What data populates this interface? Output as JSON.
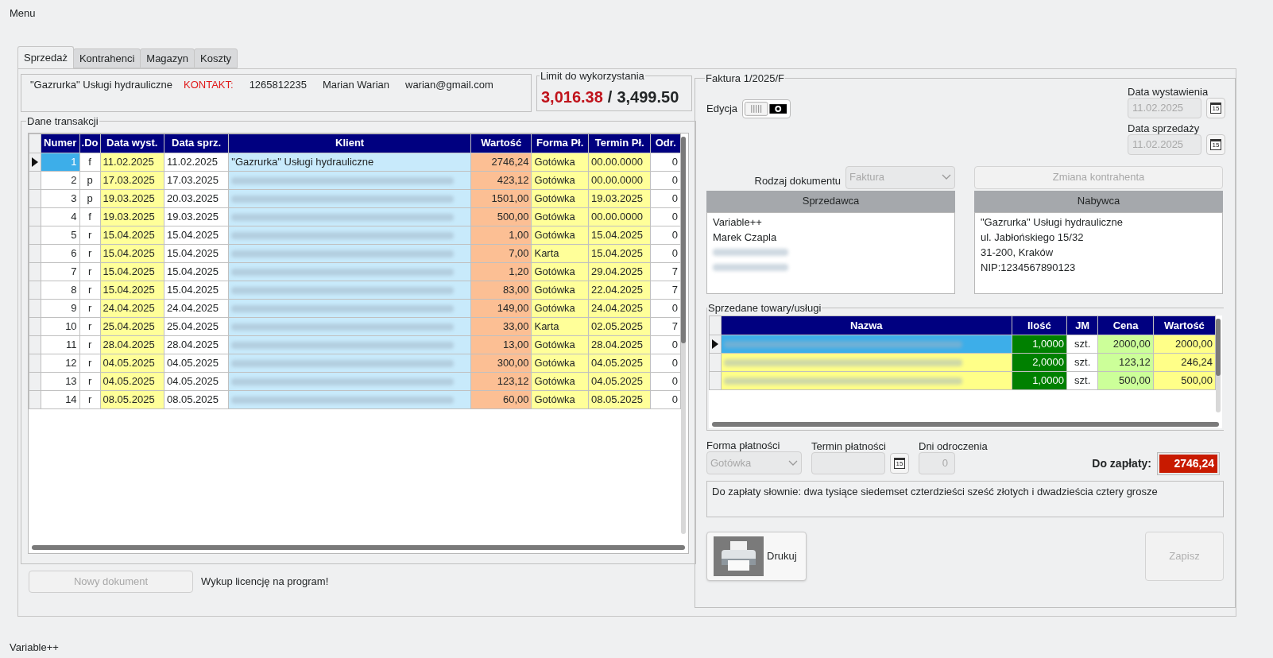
{
  "menu": {
    "label": "Menu"
  },
  "tabs": [
    {
      "label": "Sprzedaż",
      "selected": true
    },
    {
      "label": "Kontrahenci",
      "selected": false
    },
    {
      "label": "Magazyn",
      "selected": false
    },
    {
      "label": "Koszty",
      "selected": false
    }
  ],
  "contact": {
    "company": "\"Gazrurka\" Usługi hydrauliczne",
    "label": "KONTAKT:",
    "phone": "1265812235",
    "person": "Marian Warian",
    "email": "warian@gmail.com"
  },
  "limit": {
    "title": "Limit do wykorzystania",
    "used": "3,016.38",
    "separator": "/",
    "total": "3,499.50"
  },
  "transactions": {
    "title": "Dane transakcji",
    "columns": [
      "Numer",
      ".Do",
      "Data wyst.",
      "Data sprz.",
      "Klient",
      "Wartość",
      "Forma Pł.",
      "Termin Pł.",
      "Odr."
    ],
    "rows": [
      {
        "numer": "1",
        "do": "f",
        "issued": "11.02.2025",
        "sold": "11.02.2025",
        "client": {
          "kind": "text",
          "text": "\"Gazrurka\" Usługi hydrauliczne"
        },
        "value": "2746,24",
        "payment": "Gotówka",
        "due": "00.00.0000",
        "delay": "0",
        "selected": true
      },
      {
        "numer": "2",
        "do": "p",
        "issued": "17.03.2025",
        "sold": "17.03.2025",
        "client": {
          "kind": "redacted"
        },
        "value": "423,12",
        "payment": "Gotówka",
        "due": "00.00.0000",
        "delay": "0",
        "selected": false
      },
      {
        "numer": "3",
        "do": "p",
        "issued": "19.03.2025",
        "sold": "20.03.2025",
        "client": {
          "kind": "redacted"
        },
        "value": "1501,00",
        "payment": "Gotówka",
        "due": "19.03.2025",
        "delay": "0",
        "selected": false
      },
      {
        "numer": "4",
        "do": "f",
        "issued": "19.03.2025",
        "sold": "19.03.2025",
        "client": {
          "kind": "redacted"
        },
        "value": "500,00",
        "payment": "Gotówka",
        "due": "00.00.0000",
        "delay": "0",
        "selected": false
      },
      {
        "numer": "5",
        "do": "r",
        "issued": "15.04.2025",
        "sold": "15.04.2025",
        "client": {
          "kind": "redacted"
        },
        "value": "1,00",
        "payment": "Gotówka",
        "due": "15.04.2025",
        "delay": "0",
        "selected": false
      },
      {
        "numer": "6",
        "do": "r",
        "issued": "15.04.2025",
        "sold": "15.04.2025",
        "client": {
          "kind": "redacted"
        },
        "value": "7,00",
        "payment": "Karta",
        "due": "15.04.2025",
        "delay": "0",
        "selected": false
      },
      {
        "numer": "7",
        "do": "r",
        "issued": "15.04.2025",
        "sold": "15.04.2025",
        "client": {
          "kind": "redacted"
        },
        "value": "1,20",
        "payment": "Gotówka",
        "due": "29.04.2025",
        "delay": "7",
        "selected": false
      },
      {
        "numer": "8",
        "do": "r",
        "issued": "15.04.2025",
        "sold": "15.04.2025",
        "client": {
          "kind": "redacted"
        },
        "value": "83,00",
        "payment": "Gotówka",
        "due": "22.04.2025",
        "delay": "7",
        "selected": false
      },
      {
        "numer": "9",
        "do": "r",
        "issued": "24.04.2025",
        "sold": "24.04.2025",
        "client": {
          "kind": "redacted"
        },
        "value": "149,00",
        "payment": "Gotówka",
        "due": "24.04.2025",
        "delay": "0",
        "selected": false
      },
      {
        "numer": "10",
        "do": "r",
        "issued": "25.04.2025",
        "sold": "25.04.2025",
        "client": {
          "kind": "redacted"
        },
        "value": "33,00",
        "payment": "Karta",
        "due": "02.05.2025",
        "delay": "7",
        "selected": false
      },
      {
        "numer": "11",
        "do": "r",
        "issued": "28.04.2025",
        "sold": "28.04.2025",
        "client": {
          "kind": "redacted"
        },
        "value": "13,00",
        "payment": "Gotówka",
        "due": "28.04.2025",
        "delay": "0",
        "selected": false
      },
      {
        "numer": "12",
        "do": "r",
        "issued": "04.05.2025",
        "sold": "04.05.2025",
        "client": {
          "kind": "redacted"
        },
        "value": "300,00",
        "payment": "Gotówka",
        "due": "04.05.2025",
        "delay": "0",
        "selected": false
      },
      {
        "numer": "13",
        "do": "r",
        "issued": "04.05.2025",
        "sold": "04.05.2025",
        "client": {
          "kind": "redacted"
        },
        "value": "123,12",
        "payment": "Gotówka",
        "due": "04.05.2025",
        "delay": "0",
        "selected": false
      },
      {
        "numer": "14",
        "do": "r",
        "issued": "08.05.2025",
        "sold": "08.05.2025",
        "client": {
          "kind": "redacted"
        },
        "value": "60,00",
        "payment": "Gotówka",
        "due": "08.05.2025",
        "delay": "0",
        "selected": false
      }
    ]
  },
  "new_document_button": {
    "label": "Nowy dokument",
    "disabled": true
  },
  "license_note": "Wykup licencję na program!",
  "invoice": {
    "title": "Faktura 1/2025/F",
    "edit_toggle": {
      "label": "Edycja",
      "on": false
    },
    "issue_date": {
      "label": "Data wystawienia",
      "value": "11.02.2025",
      "disabled": true,
      "calendar_day": "15"
    },
    "sale_date": {
      "label": "Data sprzedaży",
      "value": "11.02.2025",
      "disabled": true,
      "calendar_day": "15"
    },
    "document_type": {
      "label": "Rodzaj dokumentu",
      "value": "Faktura",
      "disabled": true
    },
    "change_party_button": {
      "label": "Zmiana kontrahenta",
      "disabled": true
    },
    "seller": {
      "title": "Sprzedawca",
      "lines": [
        {
          "kind": "text",
          "text": "Variable++"
        },
        {
          "kind": "text",
          "text": "Marek Czapla"
        },
        {
          "kind": "redacted"
        },
        {
          "kind": "redacted"
        }
      ]
    },
    "buyer": {
      "title": "Nabywca",
      "lines": [
        {
          "kind": "text",
          "text": "\"Gazrurka\" Usługi hydrauliczne"
        },
        {
          "kind": "text",
          "text": "ul. Jabłońskiego 15/32"
        },
        {
          "kind": "text",
          "text": "31-200, Kraków"
        },
        {
          "kind": "text",
          "text": "NIP:1234567890123"
        }
      ]
    },
    "items": {
      "title": "Sprzedane towary/usługi",
      "columns": [
        "Nazwa",
        "Ilość",
        "JM",
        "Cena",
        "Wartość"
      ],
      "rows": [
        {
          "name": {
            "kind": "redacted"
          },
          "qty": "1,0000",
          "unit": "szt.",
          "price": "2000,00",
          "value": "2000,00",
          "selected": true
        },
        {
          "name": {
            "kind": "redacted"
          },
          "qty": "2,0000",
          "unit": "szt.",
          "price": "123,12",
          "value": "246,24",
          "selected": false
        },
        {
          "name": {
            "kind": "redacted"
          },
          "qty": "1,0000",
          "unit": "szt.",
          "price": "500,00",
          "value": "500,00",
          "selected": false
        }
      ]
    },
    "payment_form": {
      "label": "Forma płatności",
      "value": "Gotówka",
      "disabled": true
    },
    "payment_due": {
      "label": "Termin płatności",
      "disabled": true,
      "calendar_day": "15"
    },
    "delay_days": {
      "label": "Dni odroczenia",
      "value": "0",
      "disabled": true
    },
    "total": {
      "label": "Do zapłaty:",
      "value": "2746,24"
    },
    "in_words": "Do zapłaty słownie: dwa tysiące siedemset czterdzieści sześć złotych i dwadzieścia cztery grosze",
    "print_button": {
      "label": "Drukuj"
    },
    "save_button": {
      "label": "Zapisz",
      "disabled": true
    }
  },
  "status_bar": "Variable++"
}
